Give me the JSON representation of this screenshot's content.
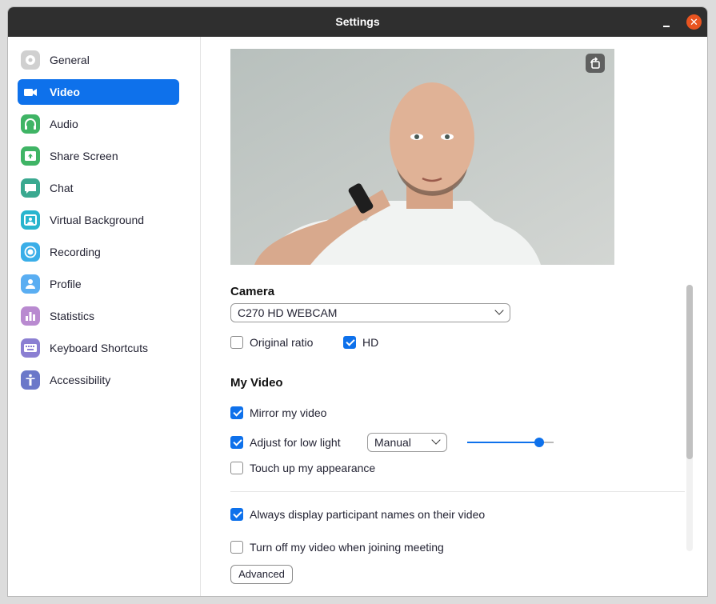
{
  "window": {
    "title": "Settings",
    "close_glyph": "✕"
  },
  "sidebar": {
    "items": [
      {
        "label": "General",
        "icon": "gear-icon",
        "color": "#c9c9c9"
      },
      {
        "label": "Video",
        "icon": "video-camera-icon",
        "color": "#0e71eb"
      },
      {
        "label": "Audio",
        "icon": "headphones-icon",
        "color": "#3fb465"
      },
      {
        "label": "Share Screen",
        "icon": "share-screen-icon",
        "color": "#3fb465"
      },
      {
        "label": "Chat",
        "icon": "chat-bubble-icon",
        "color": "#3aa990"
      },
      {
        "label": "Virtual Background",
        "icon": "portrait-icon",
        "color": "#29b5ce"
      },
      {
        "label": "Recording",
        "icon": "record-icon",
        "color": "#3aaee8"
      },
      {
        "label": "Profile",
        "icon": "person-icon",
        "color": "#5aaef2"
      },
      {
        "label": "Statistics",
        "icon": "bar-chart-icon",
        "color": "#b98ad0"
      },
      {
        "label": "Keyboard Shortcuts",
        "icon": "keyboard-icon",
        "color": "#8b7fd2"
      },
      {
        "label": "Accessibility",
        "icon": "accessibility-icon",
        "color": "#6b78c9"
      }
    ],
    "active_index": 1
  },
  "camera": {
    "section_title": "Camera",
    "device": "C270 HD WEBCAM",
    "original_ratio": {
      "label": "Original ratio",
      "checked": false
    },
    "hd": {
      "label": "HD",
      "checked": true
    }
  },
  "my_video": {
    "section_title": "My Video",
    "mirror": {
      "label": "Mirror my video",
      "checked": true
    },
    "low_light": {
      "label": "Adjust for low light",
      "checked": true,
      "mode": "Manual",
      "level": 0.83
    },
    "touch_up": {
      "label": "Touch up my appearance",
      "checked": false
    },
    "display_names": {
      "label": "Always display participant names on their video",
      "checked": true
    },
    "turn_off": {
      "label": "Turn off my video when joining meeting",
      "checked": false
    }
  },
  "advanced_label": "Advanced",
  "colors": {
    "accent": "#0e71eb",
    "titlebar": "#2f2f2f",
    "close": "#e95420"
  }
}
